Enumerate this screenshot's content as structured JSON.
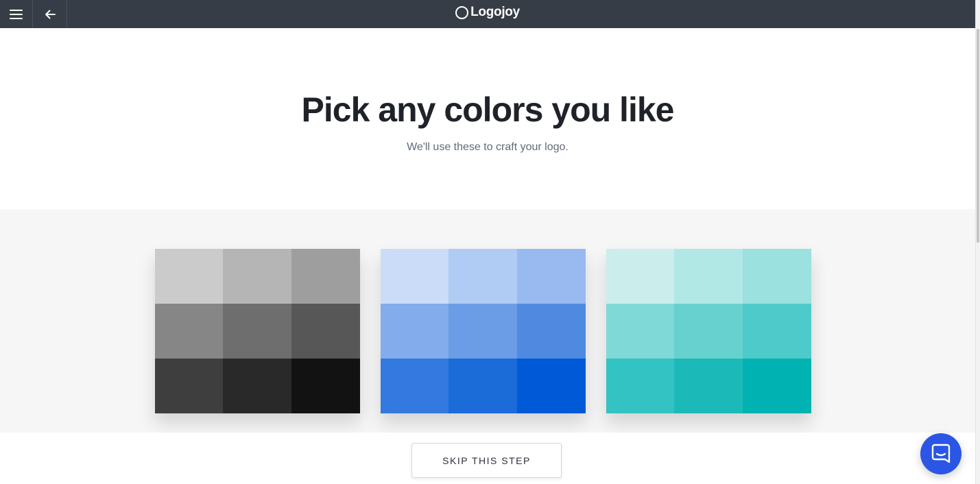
{
  "topbar": {
    "brand": "Logojoy",
    "background": "#363d46",
    "icons": {
      "menu": "hamburger-menu-icon",
      "back": "arrow-left-icon",
      "logo": "circle-logo-icon"
    }
  },
  "header": {
    "title": "Pick any colors you like",
    "subtitle": "We'll use these to craft your logo."
  },
  "palettes": [
    {
      "name": "gray",
      "swatches": [
        "#cbcbcb",
        "#b5b5b5",
        "#9e9e9e",
        "#868686",
        "#6e6e6e",
        "#575757",
        "#3e3e3e",
        "#292929",
        "#121212"
      ]
    },
    {
      "name": "blue",
      "swatches": [
        "#cadcf7",
        "#b0ccf4",
        "#98baf0",
        "#82aceb",
        "#6a9de5",
        "#4f8ae0",
        "#3479df",
        "#1b6bd9",
        "#0059d6"
      ]
    },
    {
      "name": "teal",
      "swatches": [
        "#cbeeed",
        "#b1e8e6",
        "#9ae1df",
        "#7fd9d7",
        "#66d1cf",
        "#4ecaca",
        "#33c3c2",
        "#1bbab8",
        "#00b3b2"
      ]
    }
  ],
  "footer": {
    "skip_label": "SKIP THIS STEP"
  },
  "chat": {
    "icon": "chat-bubble-icon",
    "color": "#2a55e5"
  }
}
